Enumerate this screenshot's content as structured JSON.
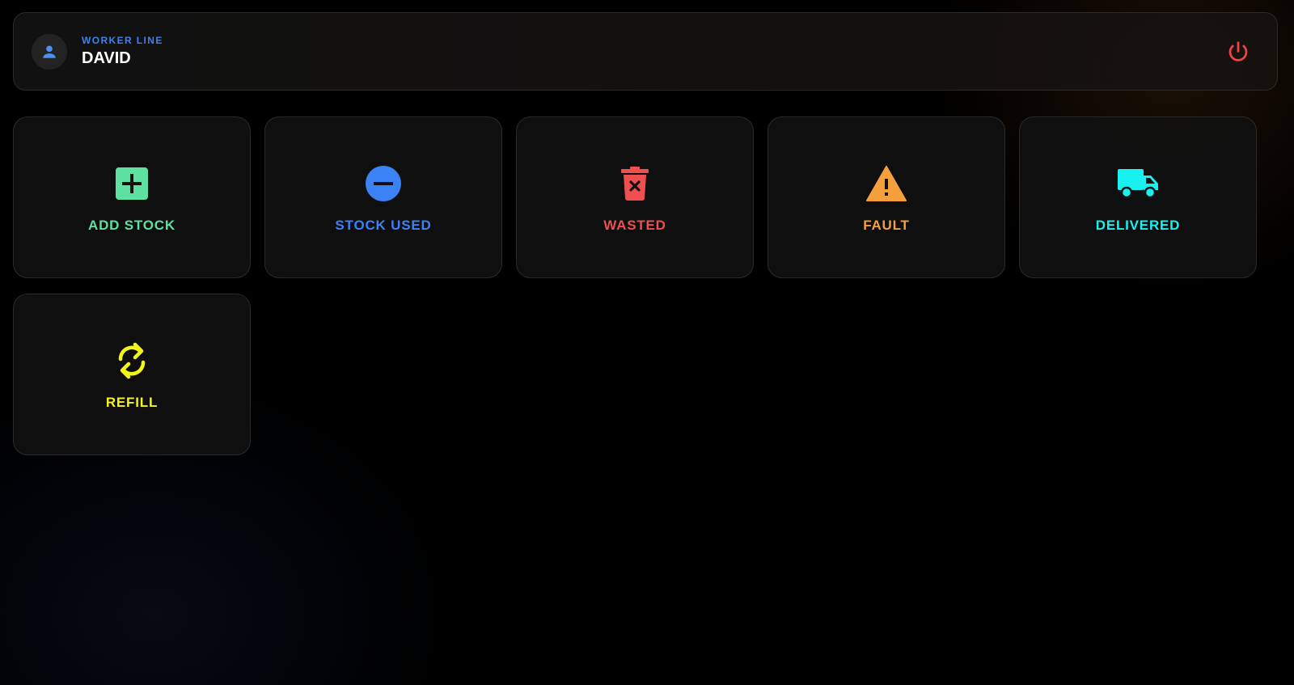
{
  "header": {
    "role_label": "WORKER LINE",
    "user_name": "DAVID",
    "role_color": "#3b82f6",
    "power_color": "#ef4444"
  },
  "tiles": [
    {
      "label": "ADD STOCK",
      "icon": "plus-square-icon",
      "color": "#5ee0a0"
    },
    {
      "label": "STOCK USED",
      "icon": "minus-circle-icon",
      "color": "#3b82f6"
    },
    {
      "label": "WASTED",
      "icon": "trash-x-icon",
      "color": "#ef4f4f"
    },
    {
      "label": "FAULT",
      "icon": "warning-triangle-icon",
      "color": "#f5a03c"
    },
    {
      "label": "DELIVERED",
      "icon": "truck-icon",
      "color": "#19f0f0"
    },
    {
      "label": "REFILL",
      "icon": "refresh-icon",
      "color": "#f4f41a"
    }
  ]
}
